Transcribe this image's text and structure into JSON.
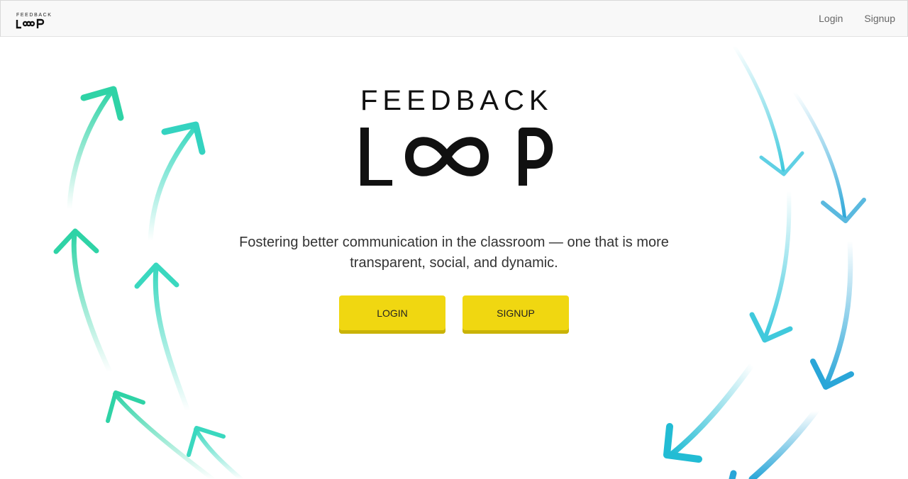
{
  "navbar": {
    "brand_top": "FEEDBACK",
    "brand_bottom": "LOOP",
    "links": [
      {
        "label": "Login"
      },
      {
        "label": "Signup"
      }
    ]
  },
  "hero": {
    "logo_top": "FEEDBACK",
    "logo_bottom": "LOOP",
    "tagline_line1": "Fostering better communication in the classroom — one that is more",
    "tagline_line2": "transparent, social, and dynamic.",
    "login_button": "LOGIN",
    "signup_button": "SIGNUP"
  },
  "colors": {
    "accent_yellow": "#f0d711",
    "arrow_green": "#2fd3a6",
    "arrow_blue": "#1fa9d6"
  },
  "icons": {
    "decor_left": "upward-arrows",
    "decor_right": "downward-arrows",
    "logo_mark": "infinity-loop"
  }
}
